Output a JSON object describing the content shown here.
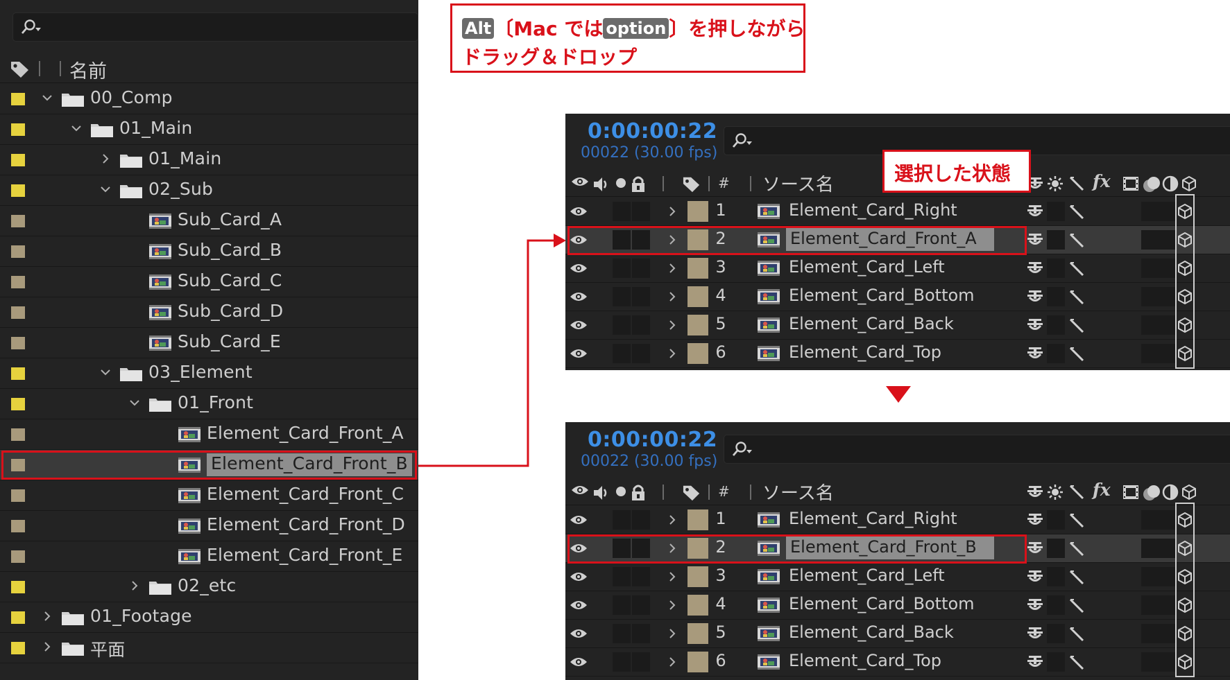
{
  "colors": {
    "accent_red": "#d9111a",
    "folder_label_yellow": "#e6d23e",
    "item_label_tan": "#a89a7c",
    "timecode_blue": "#3d8fe6",
    "panel_bg": "#232323"
  },
  "callout": {
    "key_alt": "Alt",
    "open_bracket": "〔Mac では",
    "key_option": "option",
    "close_text": "〕を押しながら",
    "line2": "ドラッグ＆ドロップ"
  },
  "project_panel": {
    "header_name": "名前",
    "rows": [
      {
        "label": "00_Comp",
        "type": "folder",
        "expanded": true,
        "swatch": "yellow",
        "icon": "folder-icon"
      },
      {
        "label": "01_Main",
        "type": "folder",
        "expanded": true,
        "swatch": "yellow",
        "icon": "folder-icon"
      },
      {
        "label": "01_Main",
        "type": "folder",
        "expanded": false,
        "swatch": "yellow",
        "icon": "folder-icon"
      },
      {
        "label": "02_Sub",
        "type": "folder",
        "expanded": true,
        "swatch": "yellow",
        "icon": "folder-icon"
      },
      {
        "label": "Sub_Card_A",
        "type": "comp",
        "swatch": "tan",
        "icon": "composition-icon"
      },
      {
        "label": "Sub_Card_B",
        "type": "comp",
        "swatch": "tan",
        "icon": "composition-icon"
      },
      {
        "label": "Sub_Card_C",
        "type": "comp",
        "swatch": "tan",
        "icon": "composition-icon"
      },
      {
        "label": "Sub_Card_D",
        "type": "comp",
        "swatch": "tan",
        "icon": "composition-icon"
      },
      {
        "label": "Sub_Card_E",
        "type": "comp",
        "swatch": "tan",
        "icon": "composition-icon"
      },
      {
        "label": "03_Element",
        "type": "folder",
        "expanded": true,
        "swatch": "yellow",
        "icon": "folder-icon"
      },
      {
        "label": "01_Front",
        "type": "folder",
        "expanded": true,
        "swatch": "yellow",
        "icon": "folder-icon"
      },
      {
        "label": "Element_Card_Front_A",
        "type": "comp",
        "swatch": "tan",
        "icon": "composition-icon"
      },
      {
        "label": "Element_Card_Front_B",
        "type": "comp",
        "swatch": "tan",
        "icon": "composition-icon",
        "selected": true
      },
      {
        "label": "Element_Card_Front_C",
        "type": "comp",
        "swatch": "tan",
        "icon": "composition-icon"
      },
      {
        "label": "Element_Card_Front_D",
        "type": "comp",
        "swatch": "tan",
        "icon": "composition-icon"
      },
      {
        "label": "Element_Card_Front_E",
        "type": "comp",
        "swatch": "tan",
        "icon": "composition-icon"
      },
      {
        "label": "02_etc",
        "type": "folder",
        "expanded": false,
        "swatch": "yellow",
        "icon": "folder-icon"
      },
      {
        "label": "01_Footage",
        "type": "folder",
        "expanded": false,
        "swatch": "yellow",
        "icon": "folder-icon"
      },
      {
        "label": "平面",
        "type": "folder",
        "expanded": false,
        "swatch": "yellow",
        "icon": "folder-icon"
      }
    ]
  },
  "timeline_top": {
    "timecode": "0:00:00:22",
    "frames": "00022 (30.00 fps)",
    "header_hash": "#",
    "header_source": "ソース名",
    "header_fx": "fx",
    "state_label": "選択した状態",
    "layers": [
      {
        "num": "1",
        "name": "Element_Card_Right"
      },
      {
        "num": "2",
        "name": "Element_Card_Front_A",
        "selected": true
      },
      {
        "num": "3",
        "name": "Element_Card_Left"
      },
      {
        "num": "4",
        "name": "Element_Card_Bottom"
      },
      {
        "num": "5",
        "name": "Element_Card_Back"
      },
      {
        "num": "6",
        "name": "Element_Card_Top"
      }
    ]
  },
  "timeline_bottom": {
    "timecode": "0:00:00:22",
    "frames": "00022 (30.00 fps)",
    "header_hash": "#",
    "header_source": "ソース名",
    "header_fx": "fx",
    "layers": [
      {
        "num": "1",
        "name": "Element_Card_Right"
      },
      {
        "num": "2",
        "name": "Element_Card_Front_B",
        "selected": true
      },
      {
        "num": "3",
        "name": "Element_Card_Left"
      },
      {
        "num": "4",
        "name": "Element_Card_Bottom"
      },
      {
        "num": "5",
        "name": "Element_Card_Back"
      },
      {
        "num": "6",
        "name": "Element_Card_Top"
      }
    ]
  }
}
